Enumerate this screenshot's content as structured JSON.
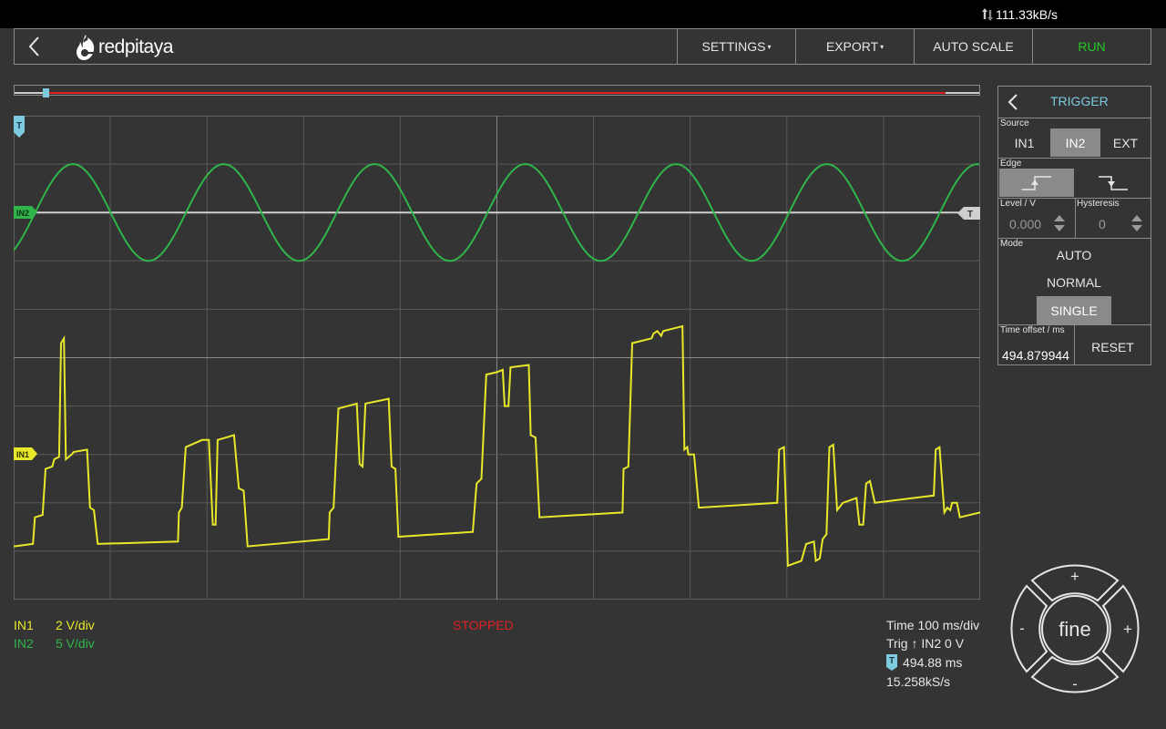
{
  "status": {
    "net_rate": "111.33kB/s"
  },
  "header": {
    "logo_text": "redpitaya",
    "menu": [
      {
        "label": "SETTINGS",
        "caret": "▾"
      },
      {
        "label": "EXPORT",
        "caret": "▾"
      },
      {
        "label": "AUTO SCALE"
      },
      {
        "label": "RUN"
      }
    ]
  },
  "colors": {
    "in1": "#e8e82a",
    "in2": "#2fb54a",
    "trigger": "#7ecbe0",
    "stopped": "#e02020",
    "run": "#22cc22"
  },
  "plot": {
    "markers": {
      "trigger_top": "T",
      "in2": "IN2",
      "in1": "IN1",
      "trigger_level": "T"
    }
  },
  "footer": {
    "in1_label": "IN1",
    "in1_scale": "2 V/div",
    "in2_label": "IN2",
    "in2_scale": "5 V/div",
    "state": "STOPPED",
    "time": "Time 100 ms/div",
    "trig": "Trig ↑ IN2 0 V",
    "offset_marker": "T",
    "offset": "494.88 ms",
    "rate": "15.258kS/s"
  },
  "trigger": {
    "title": "TRIGGER",
    "source_label": "Source",
    "sources": [
      "IN1",
      "IN2",
      "EXT"
    ],
    "source_selected": "IN2",
    "edge_label": "Edge",
    "edge_selected": "rising",
    "level_label": "Level / V",
    "level_value": "0.000",
    "hysteresis_label": "Hysteresis",
    "hysteresis_value": "0",
    "mode_label": "Mode",
    "modes": [
      "AUTO",
      "NORMAL",
      "SINGLE"
    ],
    "mode_selected": "SINGLE",
    "offset_label": "Time offset / ms",
    "offset_value": "494.879944",
    "reset_label": "RESET"
  },
  "jog": {
    "center": "fine",
    "plus_top": "+",
    "plus_right": "+",
    "minus_left": "-",
    "minus_bottom": "-"
  },
  "waveforms": {
    "in2": {
      "type": "sine",
      "period_div": 1.56,
      "amplitude_div": 1.0,
      "phase_start": -0.9
    },
    "in1_points": [
      [
        0.0,
        8.9
      ],
      [
        0.2,
        8.85
      ],
      [
        0.22,
        8.3
      ],
      [
        0.3,
        8.25
      ],
      [
        0.33,
        7.3
      ],
      [
        0.4,
        7.25
      ],
      [
        0.42,
        7.1
      ],
      [
        0.47,
        7.05
      ],
      [
        0.49,
        4.7
      ],
      [
        0.52,
        4.6
      ],
      [
        0.54,
        7.1
      ],
      [
        0.6,
        7.0
      ],
      [
        0.62,
        6.95
      ],
      [
        0.76,
        6.9
      ],
      [
        0.79,
        8.1
      ],
      [
        0.83,
        8.15
      ],
      [
        0.87,
        8.85
      ],
      [
        1.7,
        8.8
      ],
      [
        1.71,
        8.2
      ],
      [
        1.74,
        8.1
      ],
      [
        1.78,
        6.85
      ],
      [
        1.95,
        6.7
      ],
      [
        2.02,
        6.7
      ],
      [
        2.06,
        8.45
      ],
      [
        2.09,
        8.45
      ],
      [
        2.11,
        6.7
      ],
      [
        2.2,
        6.65
      ],
      [
        2.28,
        6.6
      ],
      [
        2.33,
        7.7
      ],
      [
        2.38,
        7.75
      ],
      [
        2.42,
        8.9
      ],
      [
        3.26,
        8.75
      ],
      [
        3.27,
        8.2
      ],
      [
        3.31,
        8.1
      ],
      [
        3.36,
        6.05
      ],
      [
        3.55,
        5.95
      ],
      [
        3.58,
        7.2
      ],
      [
        3.61,
        7.25
      ],
      [
        3.64,
        5.95
      ],
      [
        3.88,
        5.85
      ],
      [
        3.91,
        7.25
      ],
      [
        3.95,
        7.3
      ],
      [
        3.98,
        8.7
      ],
      [
        4.75,
        8.6
      ],
      [
        4.79,
        7.6
      ],
      [
        4.84,
        7.5
      ],
      [
        4.89,
        5.35
      ],
      [
        5.0,
        5.3
      ],
      [
        5.06,
        5.25
      ],
      [
        5.08,
        6.0
      ],
      [
        5.12,
        6.0
      ],
      [
        5.14,
        5.2
      ],
      [
        5.33,
        5.15
      ],
      [
        5.35,
        6.6
      ],
      [
        5.4,
        6.65
      ],
      [
        5.44,
        8.3
      ],
      [
        6.3,
        8.2
      ],
      [
        6.31,
        7.3
      ],
      [
        6.36,
        7.25
      ],
      [
        6.4,
        4.7
      ],
      [
        6.6,
        4.6
      ],
      [
        6.62,
        4.5
      ],
      [
        6.66,
        4.45
      ],
      [
        6.7,
        4.55
      ],
      [
        6.72,
        4.45
      ],
      [
        6.92,
        4.35
      ],
      [
        6.94,
        6.9
      ],
      [
        6.97,
        6.85
      ],
      [
        6.98,
        7.0
      ],
      [
        7.04,
        7.0
      ],
      [
        7.09,
        8.1
      ],
      [
        7.9,
        8.0
      ],
      [
        7.92,
        6.9
      ],
      [
        7.97,
        6.85
      ],
      [
        8.01,
        9.3
      ],
      [
        8.15,
        9.2
      ],
      [
        8.2,
        8.85
      ],
      [
        8.28,
        8.8
      ],
      [
        8.3,
        9.2
      ],
      [
        8.34,
        9.15
      ],
      [
        8.37,
        8.75
      ],
      [
        8.41,
        8.65
      ],
      [
        8.44,
        6.85
      ],
      [
        8.48,
        6.8
      ],
      [
        8.52,
        8.15
      ],
      [
        8.58,
        8.0
      ],
      [
        8.72,
        7.9
      ],
      [
        8.75,
        8.45
      ],
      [
        8.79,
        8.45
      ],
      [
        8.82,
        7.6
      ],
      [
        8.86,
        7.55
      ],
      [
        8.91,
        8.0
      ],
      [
        9.52,
        7.85
      ],
      [
        9.54,
        6.9
      ],
      [
        9.58,
        6.85
      ],
      [
        9.63,
        8.2
      ],
      [
        9.66,
        8.1
      ],
      [
        9.69,
        8.15
      ],
      [
        9.71,
        8.0
      ],
      [
        9.76,
        8.0
      ],
      [
        9.79,
        8.3
      ],
      [
        10.0,
        8.2
      ]
    ]
  }
}
